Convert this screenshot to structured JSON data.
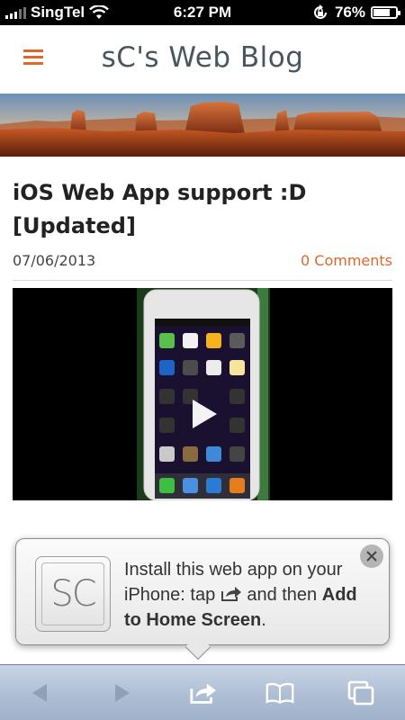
{
  "status_bar": {
    "carrier": "SingTel",
    "time": "6:27 PM",
    "battery_percent_label": "76%",
    "battery_level": 0.76
  },
  "header": {
    "menu_icon": "hamburger-icon",
    "title": "sC's Web Blog"
  },
  "post": {
    "title": "iOS Web App support :D [Updated]",
    "date": "07/06/2013",
    "comments_link": "0 Comments"
  },
  "install_popup": {
    "icon_text": "SC",
    "text_before": "Install this web app on your iPhone: tap",
    "text_middle": "and then",
    "text_bold": "Add to Home Screen",
    "text_end": ".",
    "close_icon": "close-icon"
  },
  "toolbar": {
    "icons": [
      "back-arrow-icon",
      "forward-arrow-icon",
      "share-icon",
      "bookmarks-icon",
      "pages-icon"
    ]
  },
  "colors": {
    "accent": "#e0672a",
    "title_text": "#4a5560",
    "toolbar_blue": "#aebed4"
  }
}
